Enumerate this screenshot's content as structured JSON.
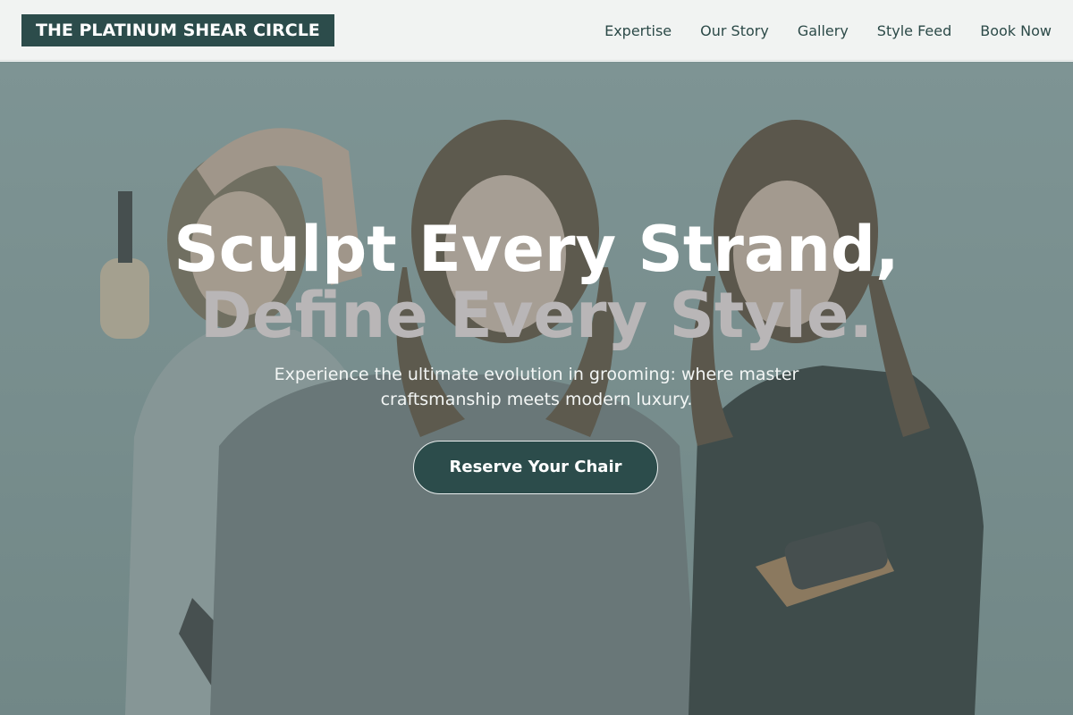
{
  "brand": {
    "name": "THE PLATINUM SHEAR CIRCLE"
  },
  "nav": {
    "items": [
      "Expertise",
      "Our Story",
      "Gallery",
      "Style Feed",
      "Book Now"
    ]
  },
  "hero": {
    "headline_line1": "Sculpt Every Strand,",
    "headline_line2": "Define Every Style.",
    "subtext": "Experience the ultimate evolution in grooming: where master craftsmanship meets modern luxury.",
    "cta_label": "Reserve Your Chair",
    "image": "three stylists holding brushes and scissors"
  },
  "colors": {
    "brand": "#2c4c4b",
    "nav_bg": "#f1f3f2",
    "accent_text": "#b9b6b7"
  }
}
